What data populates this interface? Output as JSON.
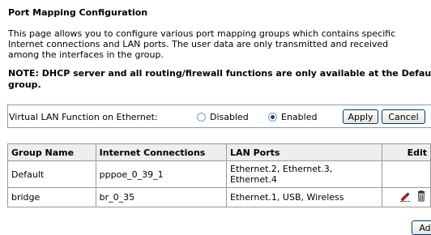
{
  "page": {
    "title": "Port Mapping Configuration",
    "description_lines": [
      "This page allows you to configure various port mapping groups which contains specific",
      "Internet connections and LAN ports. The user data are only transmitted and received",
      "among the interfaces in the group."
    ],
    "note_lines": [
      "NOTE: DHCP server and all routing/firewall functions are only available at the Default",
      "group."
    ]
  },
  "vlan": {
    "label": "Virtual LAN Function on Ethernet:",
    "options": [
      "Disabled",
      "Enabled"
    ],
    "selected": "Enabled",
    "apply_label": "Apply",
    "cancel_label": "Cancel"
  },
  "table": {
    "headers": [
      "Group Name",
      "Internet Connections",
      "LAN Ports",
      "Edit"
    ],
    "rows": [
      {
        "group": "Default",
        "connections": "pppoe_0_39_1",
        "lan_ports_lines": [
          "Ethernet.2, Ethernet.3,",
          "Ethernet.4"
        ]
      },
      {
        "group": "bridge",
        "connections": "br_0_35",
        "lan_ports_lines": [
          "Ethernet.1, USB, Wireless"
        ],
        "icons": [
          "edit-icon",
          "delete-icon"
        ]
      }
    ]
  },
  "add_label": "Add"
}
